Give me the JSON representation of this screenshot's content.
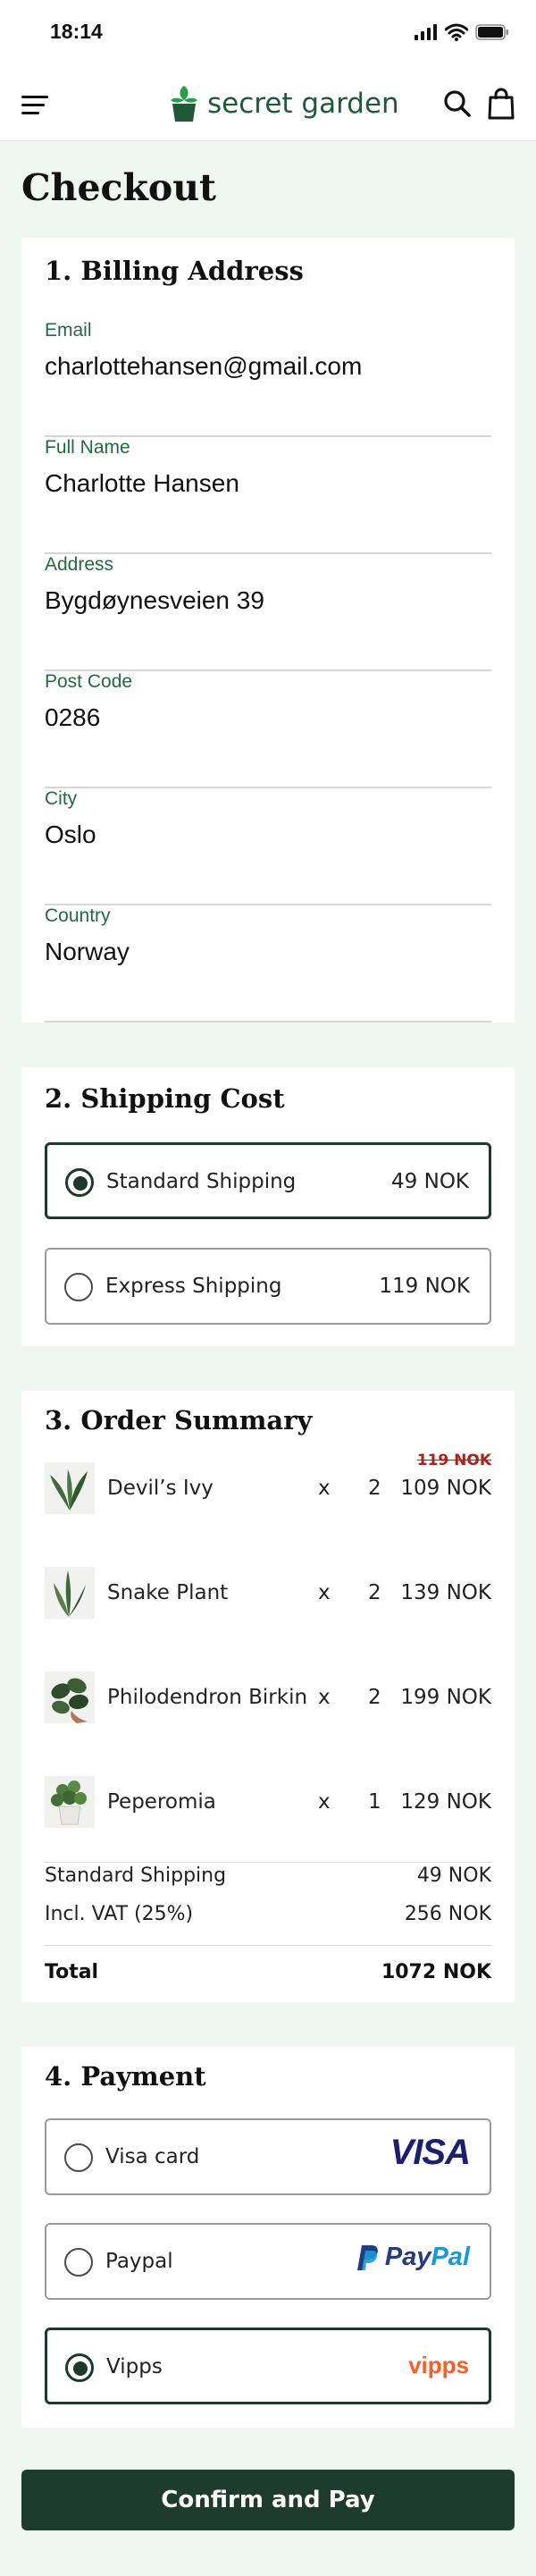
{
  "status_bar": {
    "time": "18:14"
  },
  "header": {
    "brand": "secret garden"
  },
  "page": {
    "title": "Checkout"
  },
  "billing": {
    "title": "1. Billing Address",
    "fields": [
      {
        "label": "Email",
        "value": "charlottehansen@gmail.com"
      },
      {
        "label": "Full Name",
        "value": "Charlotte Hansen"
      },
      {
        "label": "Address",
        "value": "Bygdøynesveien 39"
      },
      {
        "label": "Post Code",
        "value": "0286"
      },
      {
        "label": "City",
        "value": "Oslo"
      },
      {
        "label": "Country",
        "value": "Norway"
      }
    ]
  },
  "shipping": {
    "title": "2. Shipping Cost",
    "options": [
      {
        "label": "Standard Shipping",
        "price": "49 NOK",
        "selected": true
      },
      {
        "label": "Express Shipping",
        "price": "119 NOK",
        "selected": false
      }
    ]
  },
  "summary": {
    "title": "3. Order Summary",
    "items": [
      {
        "name": "Devil’s Ivy",
        "x": "x",
        "qty": "2",
        "price": "109 NOK",
        "old_price": "119 NOK"
      },
      {
        "name": "Snake Plant",
        "x": "x",
        "qty": "2",
        "price": "139 NOK"
      },
      {
        "name": "Philodendron Birkin",
        "x": "x",
        "qty": "2",
        "price": "199 NOK"
      },
      {
        "name": "Peperomia",
        "x": "x",
        "qty": "1",
        "price": "129 NOK"
      }
    ],
    "shipping_label": "Standard Shipping",
    "shipping_value": "49 NOK",
    "vat_label": "Incl. VAT (25%)",
    "vat_value": "256 NOK",
    "total_label": "Total",
    "total_value": "1072 NOK"
  },
  "payment": {
    "title": "4. Payment",
    "options": [
      {
        "label": "Visa card",
        "logo_text": "VISA",
        "selected": false
      },
      {
        "label": "Paypal",
        "logo_text_a": "Pay",
        "logo_text_b": "Pal",
        "selected": false
      },
      {
        "label": "Vipps",
        "logo_text": "vipps",
        "selected": true
      }
    ]
  },
  "actions": {
    "confirm_label": "Confirm and Pay"
  },
  "colors": {
    "brand_green": "#1f5a38",
    "accent_dark": "#1e3b30",
    "label_green": "#226a42",
    "page_bg": "#eef6f1",
    "visa_blue": "#1a1f71",
    "paypal_dark": "#253b80",
    "paypal_light": "#179bd7",
    "vipps_orange": "#ff5b24",
    "sale_red": "#b02018"
  },
  "icons": [
    "signal-icon",
    "wifi-icon",
    "battery-icon",
    "menu-icon",
    "logo-plant-icon",
    "search-icon",
    "shopping-bag-icon"
  ]
}
